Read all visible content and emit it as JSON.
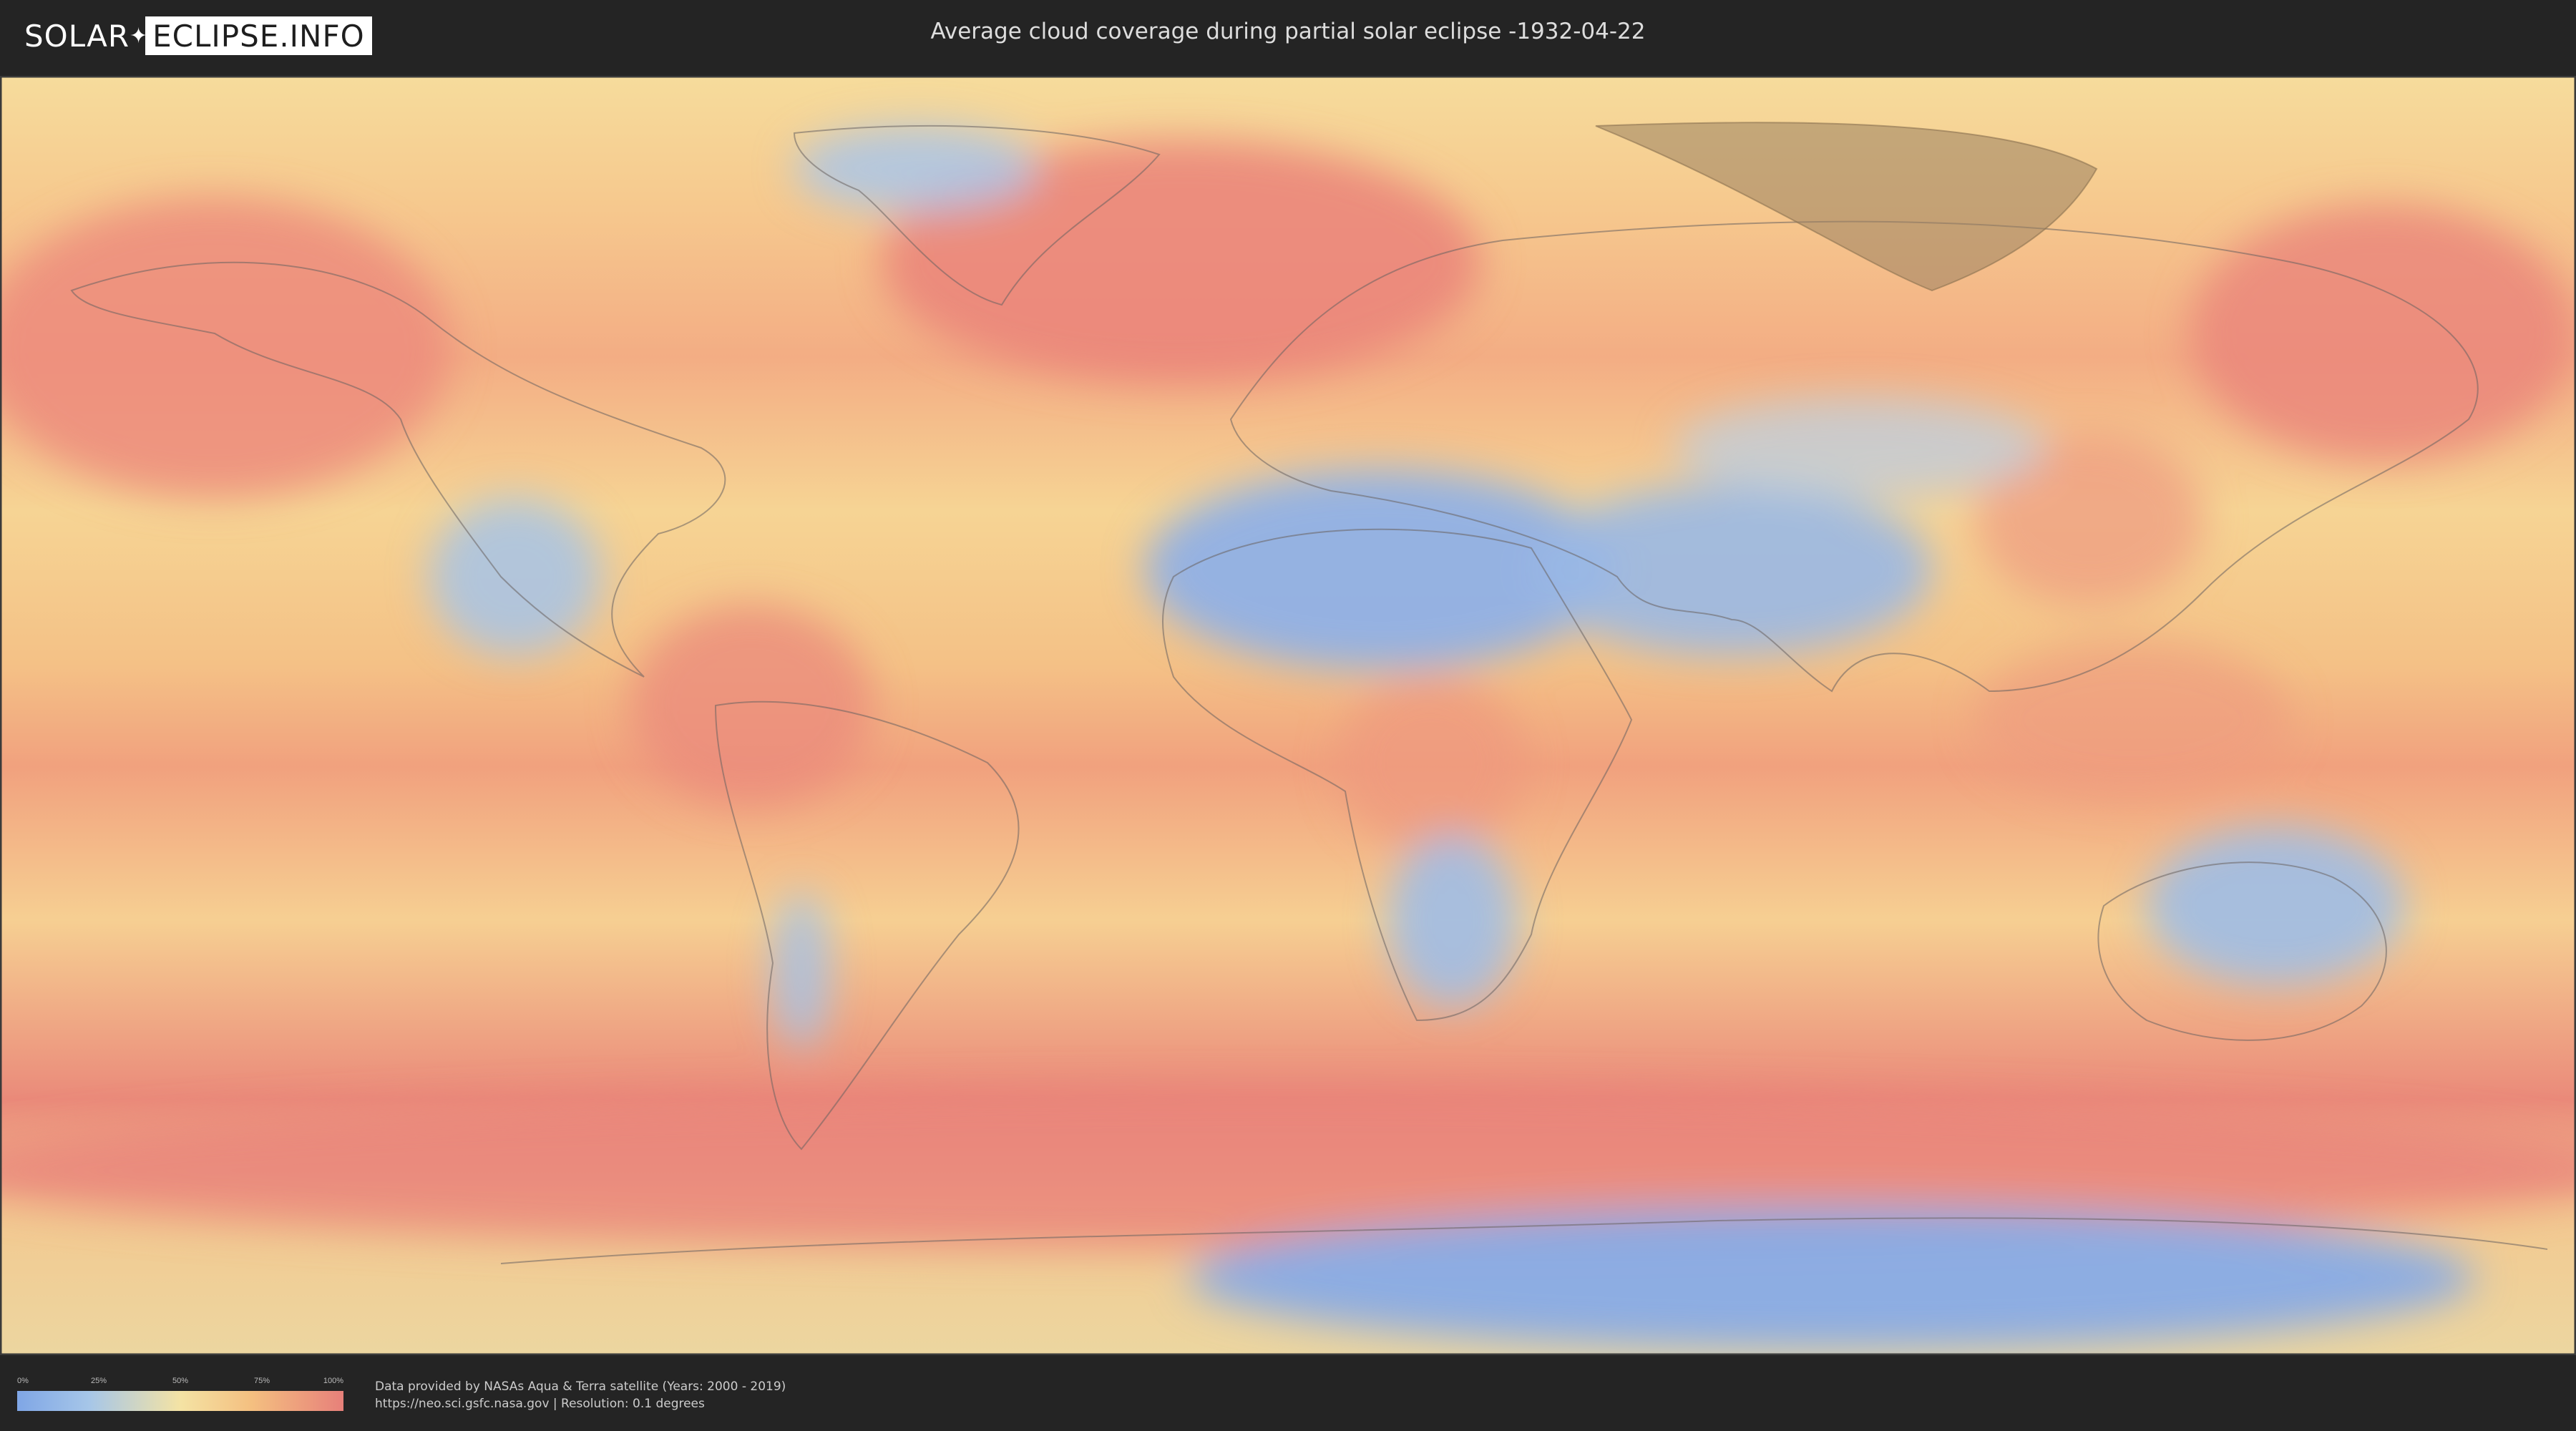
{
  "header": {
    "logo_part1": "SOLAR",
    "logo_part2": "ECLIPSE.INFO",
    "title": "Average cloud coverage during partial solar eclipse -1932-04-22"
  },
  "map": {
    "type": "cloud-coverage-world-map",
    "color_scale": [
      "#7fa6e6",
      "#a6c6e8",
      "#f4e3a4",
      "#f4bf80",
      "#e7807a"
    ],
    "eclipse_zone_color": "#9a8260"
  },
  "legend": {
    "ticks": [
      "0%",
      "25%",
      "50%",
      "75%",
      "100%"
    ]
  },
  "footer": {
    "credit_line1": "Data provided by NASAs Aqua & Terra satellite (Years: 2000 - 2019)",
    "credit_line2": "https://neo.sci.gsfc.nasa.gov | Resolution: 0.1 degrees"
  }
}
